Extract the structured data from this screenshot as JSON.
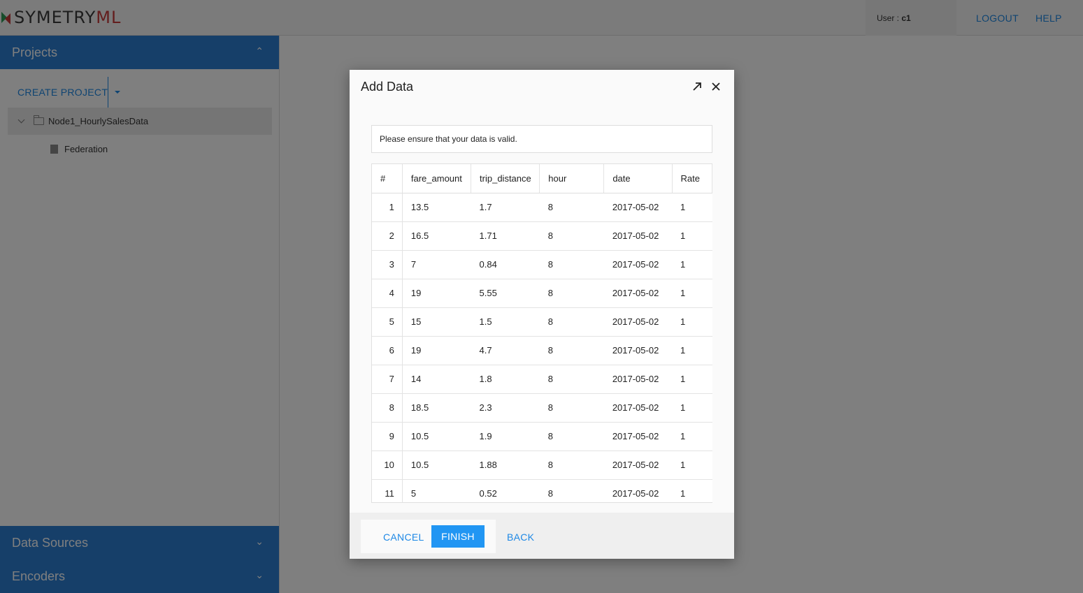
{
  "header": {
    "logo_main": "SYMETRY",
    "logo_accent": "ML",
    "user_prefix": "User : ",
    "user_name": "c1",
    "logout_label": "LOGOUT",
    "help_label": "HELP"
  },
  "sidebar": {
    "projects_title": "Projects",
    "create_project_label": "CREATE PROJECT",
    "tree": {
      "folder_label": "Node1_HourlySalesData",
      "file_label": "Federation"
    },
    "data_sources_title": "Data Sources",
    "encoders_title": "Encoders"
  },
  "dialog": {
    "title": "Add Data",
    "notice": "Please ensure that your data is valid.",
    "table": {
      "columns": [
        "#",
        "fare_amount",
        "trip_distance",
        "hour",
        "date",
        "Rate"
      ],
      "rows": [
        [
          "1",
          "13.5",
          "1.7",
          "8",
          "2017-05-02",
          "1"
        ],
        [
          "2",
          "16.5",
          "1.71",
          "8",
          "2017-05-02",
          "1"
        ],
        [
          "3",
          "7",
          "0.84",
          "8",
          "2017-05-02",
          "1"
        ],
        [
          "4",
          "19",
          "5.55",
          "8",
          "2017-05-02",
          "1"
        ],
        [
          "5",
          "15",
          "1.5",
          "8",
          "2017-05-02",
          "1"
        ],
        [
          "6",
          "19",
          "4.7",
          "8",
          "2017-05-02",
          "1"
        ],
        [
          "7",
          "14",
          "1.8",
          "8",
          "2017-05-02",
          "1"
        ],
        [
          "8",
          "18.5",
          "2.3",
          "8",
          "2017-05-02",
          "1"
        ],
        [
          "9",
          "10.5",
          "1.9",
          "8",
          "2017-05-02",
          "1"
        ],
        [
          "10",
          "10.5",
          "1.88",
          "8",
          "2017-05-02",
          "1"
        ],
        [
          "11",
          "5",
          "0.52",
          "8",
          "2017-05-02",
          "1"
        ]
      ]
    },
    "cancel_label": "CANCEL",
    "finish_label": "FINISH",
    "back_label": "BACK"
  },
  "colors": {
    "accent": "#1e88e5",
    "panel_blue": "#2d7fd3",
    "primary_button": "#2196f3",
    "logo_red": "#c63b3b",
    "logo_green": "#2f9a57"
  }
}
